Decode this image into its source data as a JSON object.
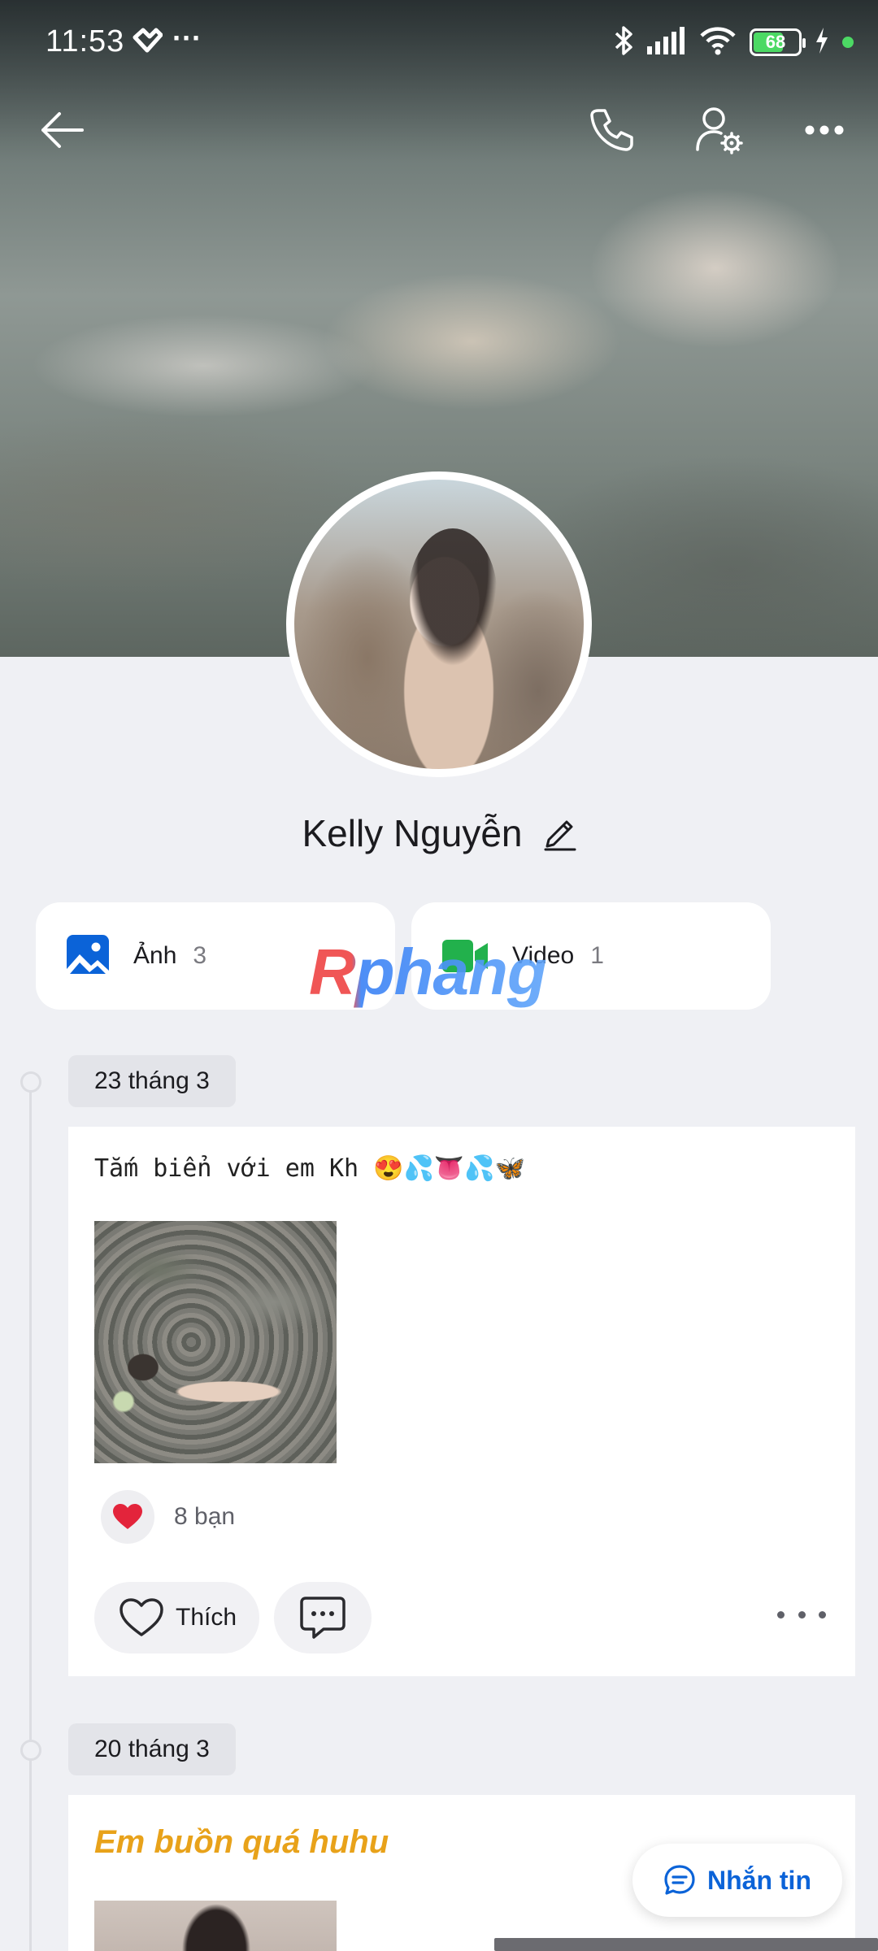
{
  "status_bar": {
    "time": "11:53",
    "battery": "68",
    "accent_charge": "#4cd964"
  },
  "header": {
    "back_icon": "arrow-left-icon",
    "call_icon": "phone-icon",
    "settings_icon": "user-settings-icon",
    "more_icon": "more-horizontal-icon"
  },
  "profile": {
    "name": "Kelly Nguyễn",
    "edit_icon": "pencil-icon"
  },
  "media": {
    "photos": {
      "label": "Ảnh",
      "count": "3",
      "icon": "image-icon",
      "color": "#0b63d8"
    },
    "videos": {
      "label": "Video",
      "count": "1",
      "icon": "video-camera-icon",
      "color": "#22b14c"
    }
  },
  "watermark": "Rphang",
  "timeline": [
    {
      "date": "23 tháng 3",
      "text": "Tắm biển với em Kh 😍💦👅💦🦋",
      "reactions": {
        "icon": "heart-icon",
        "count_text": "8 bạn"
      },
      "actions": {
        "like_label": "Thích",
        "comment_icon": "comment-icon",
        "more_icon": "more-horizontal-icon"
      }
    },
    {
      "date": "20 tháng 3",
      "text": "Em buồn quá huhu",
      "text_color": "#e8a21a"
    }
  ],
  "message_button": {
    "label": "Nhắn tin",
    "icon": "chat-bubble-icon",
    "color": "#0b63d8"
  }
}
